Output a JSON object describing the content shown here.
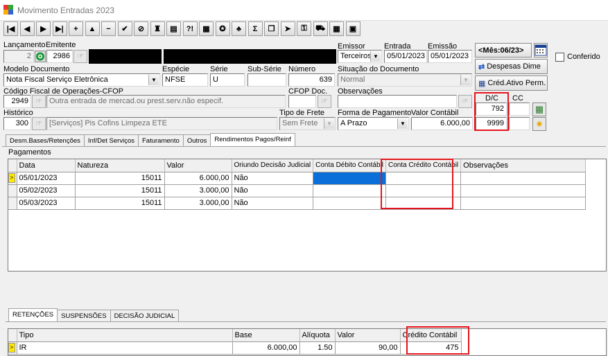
{
  "window": {
    "title": "Movimento Entradas 2023"
  },
  "toolbar": {
    "buttons": [
      {
        "name": "first-record-button",
        "glyph": "|◀"
      },
      {
        "name": "prior-record-button",
        "glyph": "◀"
      },
      {
        "name": "next-record-button",
        "glyph": "▶"
      },
      {
        "name": "last-record-button",
        "glyph": "▶|"
      },
      {
        "name": "insert-button",
        "glyph": "+"
      },
      {
        "name": "edit-button",
        "glyph": "▲"
      },
      {
        "name": "delete-button",
        "glyph": "−"
      },
      {
        "name": "post-button",
        "glyph": "✔"
      },
      {
        "name": "cancel-button",
        "glyph": "⊘"
      },
      {
        "name": "print-button",
        "glyph": "♜"
      },
      {
        "name": "export-button",
        "glyph": "▤"
      },
      {
        "name": "help-button",
        "glyph": "?!"
      },
      {
        "name": "calc-grid-button",
        "glyph": "▦"
      },
      {
        "name": "tax-button",
        "glyph": "✪"
      },
      {
        "name": "items-button",
        "glyph": "♣"
      },
      {
        "name": "sum-button",
        "glyph": "Σ"
      },
      {
        "name": "copy-button",
        "glyph": "❐"
      },
      {
        "name": "import-button",
        "glyph": "➤"
      },
      {
        "name": "key-button",
        "glyph": "⚿"
      },
      {
        "name": "transport-button",
        "glyph": "⛟"
      },
      {
        "name": "calendar-button",
        "glyph": "▦"
      },
      {
        "name": "window-button",
        "glyph": "▣"
      }
    ]
  },
  "labels": {
    "lancamento": "Lançamento",
    "emitente": "Emitente",
    "emissor": "Emissor",
    "entrada": "Entrada",
    "emissao": "Emissão",
    "modelo": "Modelo Documento",
    "especie": "Espécie",
    "serie": "Série",
    "subserie": "Sub-Série",
    "numero": "Número",
    "situacao": "Situação do Documento",
    "cfop": "Código Fiscal de Operações-CFOP",
    "cfop_doc": "CFOP Doc.",
    "observacoes": "Observações",
    "historico": "Histórico",
    "tipo_frete": "Tipo de Frete",
    "forma_pagamento": "Forma de Pagamento",
    "valor_contabil": "Valor Contábil",
    "dc": "D/C",
    "cc": "CC",
    "pagamentos": "Pagamentos",
    "conferido": "Conferido"
  },
  "form": {
    "lancamento": "2",
    "emitente_code": "2986",
    "emissor": "Terceiros",
    "entrada": "05/01/2023",
    "emissao": "05/01/2023",
    "modelo": "Nota Fiscal Serviço Eletrônica",
    "especie": "NFSE",
    "serie": "U",
    "subserie": "",
    "numero": "639",
    "situacao": "Normal",
    "cfop_code": "2949",
    "cfop_desc": "Outra entrada de mercad.ou prest.serv.não especif.",
    "cfop_doc": "",
    "observacoes": "",
    "historico_code": "300",
    "historico_desc": "[Serviços] Pis Cofins Limpeza ETE",
    "tipo_frete": "Sem Frete",
    "forma_pagamento": "A Prazo",
    "valor_contabil": "6.000,00",
    "debito": "792",
    "credito": "9999",
    "cc": ""
  },
  "side": {
    "mes": "<Mês:06/23>",
    "despesas": "Despesas Dime",
    "cred_ativo": "Créd.Ativo Perm."
  },
  "tabs": [
    "Desm.Bases/Retenções",
    "Inf/Det Serviços",
    "Faturamento",
    "Outros",
    "Rendimentos Pagos/Reinf"
  ],
  "payments": {
    "columns": [
      "Data",
      "Natureza",
      "Valor",
      "Oriundo Decisão Judicial",
      "Conta Débito Contábil",
      "Conta Crédito Contábil",
      "Observações"
    ],
    "rows": [
      [
        "05/01/2023",
        "15011",
        "6.000,00",
        "Não",
        "",
        "",
        ""
      ],
      [
        "05/02/2023",
        "15011",
        "3.000,00",
        "Não",
        "",
        "",
        ""
      ],
      [
        "05/03/2023",
        "15011",
        "3.000,00",
        "Não",
        "",
        "",
        ""
      ]
    ]
  },
  "bottom_tabs": [
    "RETENÇÕES",
    "SUSPENSÕES",
    "DECISÃO JUDICIAL"
  ],
  "retencoes": {
    "columns": [
      "Tipo",
      "Base",
      "Alíquota",
      "Valor",
      "Crédito Contábil"
    ],
    "rows": [
      [
        "IR",
        "6.000,00",
        "1.50",
        "90,00",
        "475"
      ]
    ]
  },
  "colors": {
    "highlight": "#e4141c",
    "selection": "#0a6fd8",
    "indicator": "#ffe800"
  }
}
